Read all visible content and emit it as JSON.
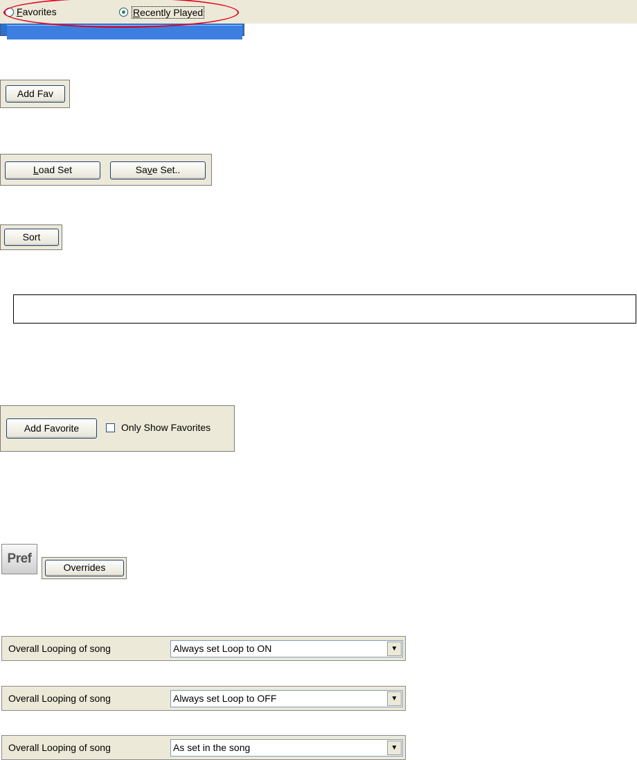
{
  "radio_strip": {
    "favorites_label": "Favorites",
    "recently_played_label": "Recently Played",
    "selected": "Recently Played"
  },
  "add_fav_button": "Add Fav",
  "set_buttons": {
    "load": "Load Set",
    "save": "Save Set.."
  },
  "sort_button": "Sort",
  "favorites_panel": {
    "add_favorite": "Add Favorite",
    "only_show_favorites": "Only Show Favorites",
    "only_show_checked": false
  },
  "pref_icon_label": "Pref",
  "overrides_button": "Overrides",
  "loop_rows": [
    {
      "label": "Overall Looping of song",
      "value": "Always set Loop to ON"
    },
    {
      "label": "Overall Looping of song",
      "value": "Always set Loop to OFF"
    },
    {
      "label": "Overall Looping of song",
      "value": "As set in the song"
    }
  ],
  "colors": {
    "accent_red": "#e3001b",
    "list_blue": "#2a6fd1",
    "panel": "#ece9d8",
    "radio_dot": "#2d8f3a"
  }
}
